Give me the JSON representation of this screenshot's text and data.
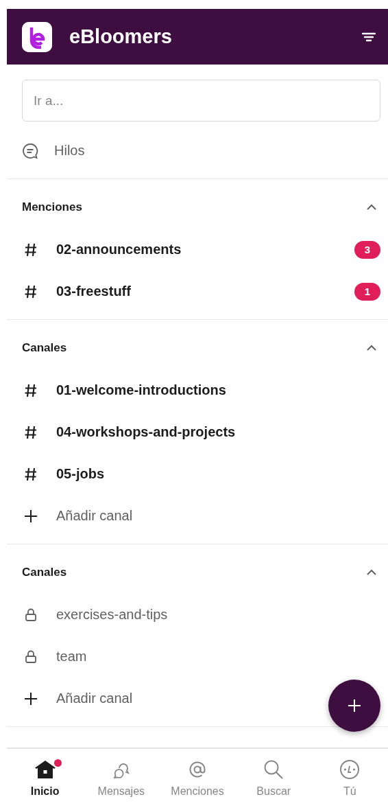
{
  "header": {
    "title": "eBloomers"
  },
  "search": {
    "placeholder": "Ir a..."
  },
  "threads": {
    "label": "Hilos"
  },
  "sections": [
    {
      "title": "Menciones",
      "expanded": true,
      "items": [
        {
          "kind": "channel",
          "name": "02-announcements",
          "unread": true,
          "badge": "3"
        },
        {
          "kind": "channel",
          "name": "03-freestuff",
          "unread": true,
          "badge": "1"
        }
      ]
    },
    {
      "title": "Canales",
      "expanded": true,
      "items": [
        {
          "kind": "channel",
          "name": "01-welcome-introductions",
          "unread": true
        },
        {
          "kind": "channel",
          "name": "04-workshops-and-projects",
          "unread": true
        },
        {
          "kind": "channel",
          "name": "05-jobs",
          "unread": true
        },
        {
          "kind": "add",
          "name": "Añadir canal",
          "unread": false
        }
      ]
    },
    {
      "title": "Canales",
      "expanded": true,
      "items": [
        {
          "kind": "private",
          "name": "exercises-and-tips",
          "unread": false
        },
        {
          "kind": "private",
          "name": "team",
          "unread": false
        },
        {
          "kind": "add",
          "name": "Añadir canal",
          "unread": false
        }
      ]
    }
  ],
  "nav": [
    {
      "kind": "home",
      "label": "Inicio",
      "selected": true,
      "notification": true
    },
    {
      "kind": "messages",
      "label": "Mensajes",
      "selected": false,
      "notification": false
    },
    {
      "kind": "mentions",
      "label": "Menciones",
      "selected": false,
      "notification": false
    },
    {
      "kind": "search",
      "label": "Buscar",
      "selected": false,
      "notification": false
    },
    {
      "kind": "profile",
      "label": "Tú",
      "selected": false,
      "notification": false
    }
  ]
}
